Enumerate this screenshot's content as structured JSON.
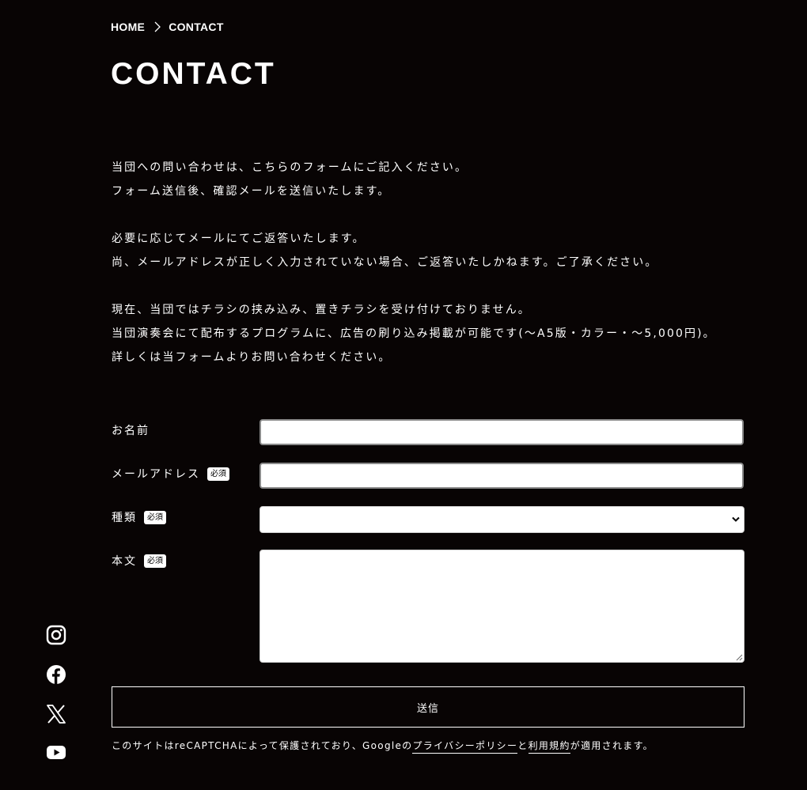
{
  "breadcrumb": {
    "home": "HOME",
    "current": "CONTACT"
  },
  "page_title": "CONTACT",
  "intro": {
    "p1_line1": "当団への問い合わせは、こちらのフォームにご記入ください。",
    "p1_line2": "フォーム送信後、確認メールを送信いたします。",
    "p2_line1": "必要に応じてメールにてご返答いたします。",
    "p2_line2": "尚、メールアドレスが正しく入力されていない場合、ご返答いたしかねます。ご了承ください。",
    "p3_line1": "現在、当団ではチラシの挟み込み、置きチラシを受け付けておりません。",
    "p3_line2": "当団演奏会にて配布するプログラムに、広告の刷り込み掲載が可能です(〜A5版・カラー・〜5,000円)。",
    "p3_line3": "詳しくは当フォームよりお問い合わせください。"
  },
  "form": {
    "required_badge": "必須",
    "name_label": "お名前",
    "email_label": "メールアドレス",
    "type_label": "種類",
    "body_label": "本文",
    "name_value": "",
    "email_value": "",
    "type_selected": "",
    "body_value": "",
    "submit_label": "送信"
  },
  "recaptcha": {
    "prefix": "このサイトはreCAPTCHAによって保護されており、Googleの",
    "privacy_link": "プライバシーポリシー",
    "and": "と",
    "terms_link": "利用規約",
    "suffix": "が適用されます。"
  },
  "social": [
    "instagram-icon",
    "facebook-icon",
    "x-icon",
    "youtube-icon"
  ],
  "colors": {
    "background": "#080404",
    "text": "#ffffff",
    "input_bg": "#ffffff"
  }
}
